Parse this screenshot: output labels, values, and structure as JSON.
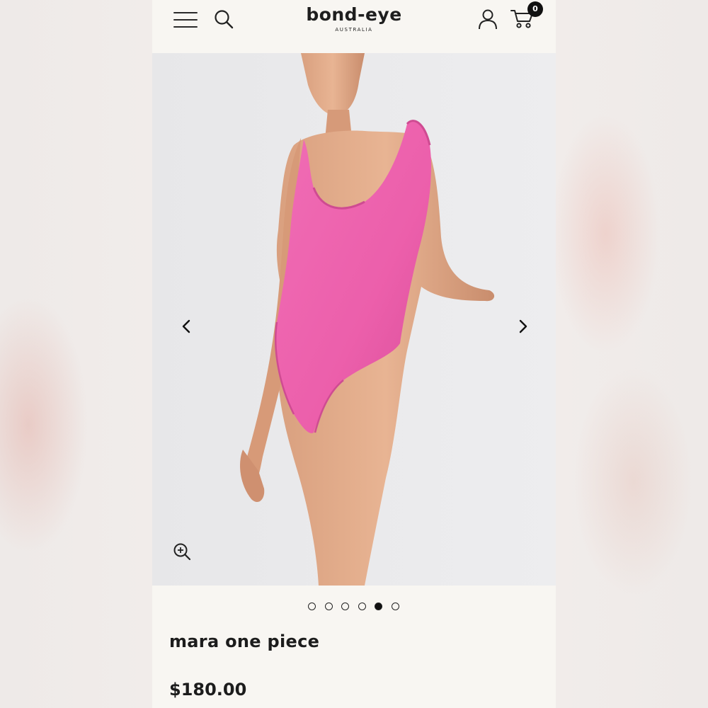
{
  "header": {
    "logo_main": "bond-eye",
    "logo_sub": "AUSTRALIA",
    "cart_count": "0",
    "icons": [
      "menu-icon",
      "search-icon",
      "user-icon",
      "cart-icon"
    ]
  },
  "gallery": {
    "image_count": 6,
    "active_index": 4,
    "icons": [
      "chevron-left-icon",
      "chevron-right-icon",
      "zoom-in-icon"
    ]
  },
  "product": {
    "title": "mara one piece",
    "price": "$180.00"
  },
  "colors": {
    "swimsuit": "#ee62ad",
    "background": "#f8f6f2",
    "text": "#1c1c1c"
  }
}
